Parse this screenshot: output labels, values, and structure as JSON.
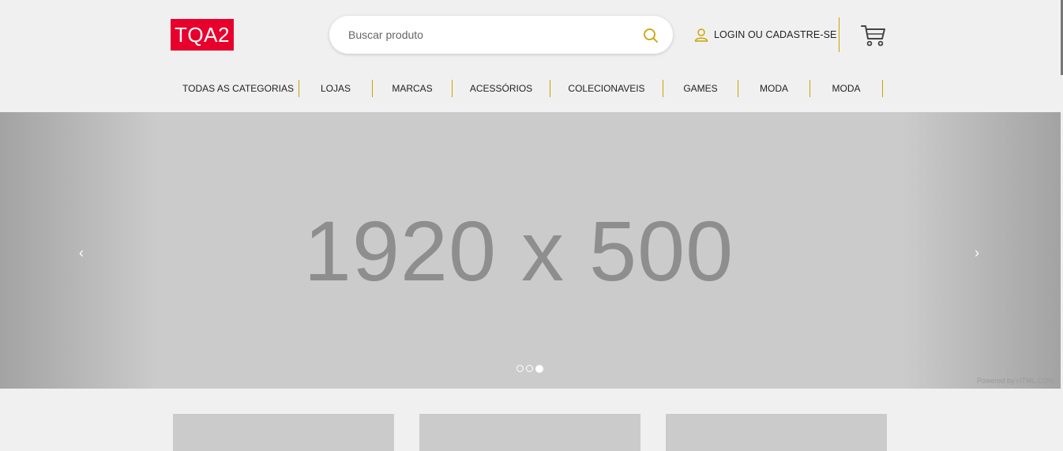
{
  "header": {
    "logo_text": "TQA2",
    "search_placeholder": "Buscar produto",
    "login_label": "LOGIN OU CADASTRE-SE",
    "icons": [
      "search-icon",
      "user-icon",
      "cart-icon"
    ],
    "accent_color": "#c9a400",
    "brand_color": "#e8002d"
  },
  "nav": {
    "items": [
      {
        "label": "TODAS AS CATEGORIAS"
      },
      {
        "label": "LOJAS"
      },
      {
        "label": "MARCAS"
      },
      {
        "label": "ACESSÓRIOS"
      },
      {
        "label": "COLECIONAVEIS"
      },
      {
        "label": "GAMES"
      },
      {
        "label": "MODA"
      },
      {
        "label": "MODA"
      }
    ]
  },
  "banner": {
    "placeholder_text": "1920 x 500",
    "prev_label": "‹",
    "next_label": "›",
    "slide_count": 3,
    "active_slide": 3,
    "powered_by": "Powered by HTML.COM"
  },
  "cards": {
    "count": 3
  }
}
